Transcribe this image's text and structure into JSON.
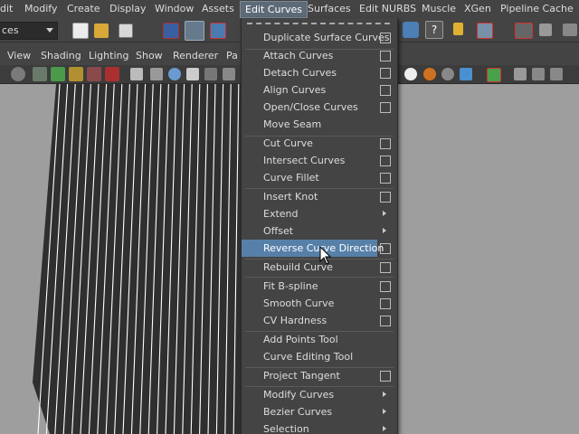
{
  "menubar": {
    "items": [
      "dit",
      "Modify",
      "Create",
      "Display",
      "Window",
      "Assets",
      "Edit Curves",
      "Surfaces",
      "Edit NURBS",
      "Muscle",
      "XGen",
      "Pipeline Cache"
    ],
    "open_item": "Edit Curves"
  },
  "mode_selector": {
    "value": "ces"
  },
  "panel_menu": {
    "items": [
      "View",
      "Shading",
      "Lighting",
      "Show",
      "Renderer",
      "Pa"
    ]
  },
  "edit_curves_menu": {
    "items": [
      {
        "label": "Duplicate Surface Curves",
        "option_box": true
      },
      {
        "label": "Attach Curves",
        "option_box": true
      },
      {
        "label": "Detach Curves",
        "option_box": true
      },
      {
        "label": "Align Curves",
        "option_box": true
      },
      {
        "label": "Open/Close Curves",
        "option_box": true
      },
      {
        "label": "Move Seam",
        "option_box": false
      },
      {
        "label": "Cut Curve",
        "option_box": true
      },
      {
        "label": "Intersect Curves",
        "option_box": true
      },
      {
        "label": "Curve Fillet",
        "option_box": true
      },
      {
        "label": "Insert Knot",
        "option_box": true
      },
      {
        "label": "Extend",
        "submenu": true
      },
      {
        "label": "Offset",
        "submenu": true
      },
      {
        "label": "Reverse Curve Direction",
        "option_box": true,
        "highlighted": true
      },
      {
        "label": "Rebuild Curve",
        "option_box": true
      },
      {
        "label": "Fit B-spline",
        "option_box": true
      },
      {
        "label": "Smooth Curve",
        "option_box": true
      },
      {
        "label": "CV Hardness",
        "option_box": true
      },
      {
        "label": "Add Points Tool",
        "option_box": false
      },
      {
        "label": "Curve Editing Tool",
        "option_box": false
      },
      {
        "label": "Project Tangent",
        "option_box": true
      },
      {
        "label": "Modify Curves",
        "submenu": true
      },
      {
        "label": "Bezier Curves",
        "submenu": true
      },
      {
        "label": "Selection",
        "submenu": true
      }
    ]
  },
  "colors": {
    "ui_background": "#444444",
    "menu_highlight": "#5780a8",
    "viewport_background": "#9e9e9e",
    "surface": "#2f2f2f",
    "isoparm": "#ffffff"
  },
  "icons": [
    "new-scene-icon",
    "open-scene-icon",
    "save-scene-icon",
    "select-hierarchy-icon",
    "select-object-icon",
    "select-component-icon",
    "snap-icon",
    "help-icon",
    "lock-icon",
    "render-icon",
    "ipr-icon",
    "render-settings-icon",
    "camera-icon",
    "grid-icon",
    "shading-icon",
    "texture-icon",
    "light-icon",
    "mouse-pointer-icon"
  ]
}
